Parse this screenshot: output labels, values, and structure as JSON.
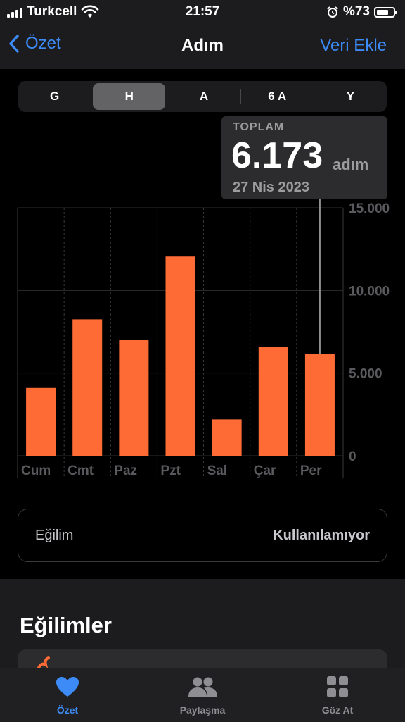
{
  "status_bar": {
    "carrier": "Turkcell",
    "time": "21:57",
    "battery": "%73",
    "battery_level": 0.73
  },
  "nav": {
    "back_label": "Özet",
    "title": "Adım",
    "action_label": "Veri Ekle"
  },
  "segments": [
    {
      "label": "G",
      "active": false
    },
    {
      "label": "H",
      "active": true
    },
    {
      "label": "A",
      "active": false
    },
    {
      "label": "6 A",
      "active": false
    },
    {
      "label": "Y",
      "active": false
    }
  ],
  "callout": {
    "label": "TOPLAM",
    "value": "6.173",
    "unit": "adım",
    "date": "27 Nis 2023"
  },
  "chart_data": {
    "type": "bar",
    "categories": [
      "Cum",
      "Cmt",
      "Paz",
      "Pzt",
      "Sal",
      "Çar",
      "Per"
    ],
    "values": [
      4100,
      8250,
      7000,
      12050,
      2200,
      6600,
      6173
    ],
    "ylim": [
      0,
      15000
    ],
    "yticks": [
      "0",
      "5.000",
      "10.000",
      "15.000"
    ],
    "selected_index": 6,
    "bar_color": "#ff6b35",
    "grid": true,
    "title": "",
    "xlabel": "",
    "ylabel": ""
  },
  "trend": {
    "label": "Eğilim",
    "value": "Kullanılamıyor"
  },
  "section": {
    "title": "Eğilimler"
  },
  "tabs": [
    {
      "label": "Özet",
      "icon": "heart-icon",
      "active": true
    },
    {
      "label": "Paylaşma",
      "icon": "people-icon",
      "active": false
    },
    {
      "label": "Göz At",
      "icon": "grid-icon",
      "active": false
    }
  ],
  "colors": {
    "accent": "#3d8bf7",
    "bar": "#ff6b35",
    "background": "#000000"
  }
}
